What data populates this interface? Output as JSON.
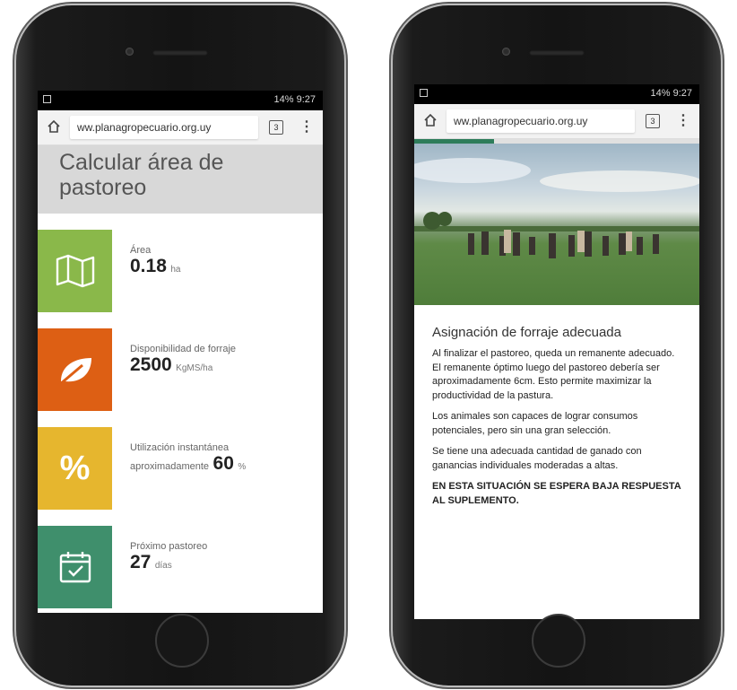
{
  "status_bar": {
    "text": "14% 9:27"
  },
  "browser": {
    "url": "ww.planagropecuario.org.uy",
    "tab_count": "3"
  },
  "calc": {
    "title": "Calcular área de pastoreo",
    "cards": [
      {
        "label": "Área",
        "value": "0.18",
        "unit": "ha",
        "icon": "map-icon",
        "color": "#8ab84a"
      },
      {
        "label": "Disponibilidad de forraje",
        "value": "2500",
        "unit": "KgMS/ha",
        "icon": "leaf-icon",
        "color": "#dd5f14"
      },
      {
        "label": "Utilización instantánea",
        "prefix": "aproximadamente",
        "value": "60",
        "unit": "%",
        "icon": "percent-icon",
        "color": "#e6b62e"
      },
      {
        "label": "Próximo pastoreo",
        "value": "27",
        "unit": "días",
        "icon": "calendar-icon",
        "color": "#3f8f6c"
      }
    ]
  },
  "article": {
    "progress": 0.28,
    "title": "Asignación de forraje adecuada",
    "paragraphs": [
      "Al finalizar el pastoreo, queda un remanente adecuado. El remanente óptimo luego del pastoreo debería ser aproximadamente 6cm. Esto permite maximizar la productividad de la pastura.",
      "Los animales son capaces de lograr consumos potenciales, pero sin una gran selección.",
      "Se tiene una adecuada cantidad de ganado con ganancias individuales moderadas a altas."
    ],
    "emphasis": "EN ESTA SITUACIÓN SE ESPERA BAJA RESPUESTA AL SUPLEMENTO."
  }
}
